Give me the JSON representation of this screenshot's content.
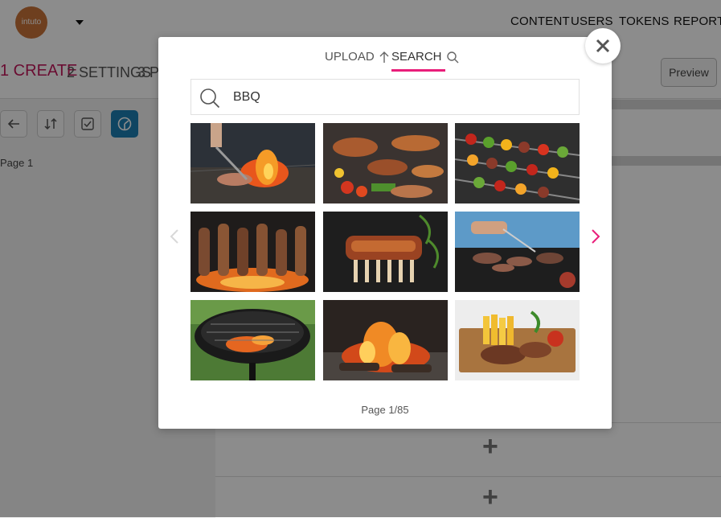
{
  "app": {
    "logo_text": "intuto",
    "nav": [
      "CONTENT",
      "USERS",
      "TOKENS",
      "REPORTS"
    ]
  },
  "steps": [
    {
      "label": "1 CREATE",
      "active": true
    },
    {
      "label": "2 SETTINGS",
      "active": false
    },
    {
      "label": "3 PU",
      "active": false
    }
  ],
  "toolbar": {
    "preview_label": "Preview",
    "tools": [
      {
        "icon": "back-arrow-icon"
      },
      {
        "icon": "sort-icon"
      },
      {
        "icon": "checkbox-icon"
      },
      {
        "icon": "palette-icon"
      }
    ]
  },
  "page_label": "Page 1",
  "modal": {
    "tabs": [
      {
        "label": "UPLOAD",
        "icon": "upload-arrow-icon",
        "active": false
      },
      {
        "label": "SEARCH",
        "icon": "search-icon",
        "active": true
      }
    ],
    "search_value": "BBQ",
    "images": [
      {
        "desc": "tongs over grill with flames"
      },
      {
        "desc": "grilled meats and vegetables"
      },
      {
        "desc": "vegetable and meat skewers"
      },
      {
        "desc": "kebabs over fire"
      },
      {
        "desc": "rack of ribs with herbs"
      },
      {
        "desc": "person grilling burgers"
      },
      {
        "desc": "round charcoal kettle grill"
      },
      {
        "desc": "campfire embers"
      },
      {
        "desc": "skewers with fries on board"
      }
    ],
    "page_info": "Page 1/85"
  },
  "colors": {
    "accent": "#e91e7a",
    "step_active": "#c2185b",
    "tool_active": "#1c7fb2",
    "logo": "#c8733a"
  }
}
